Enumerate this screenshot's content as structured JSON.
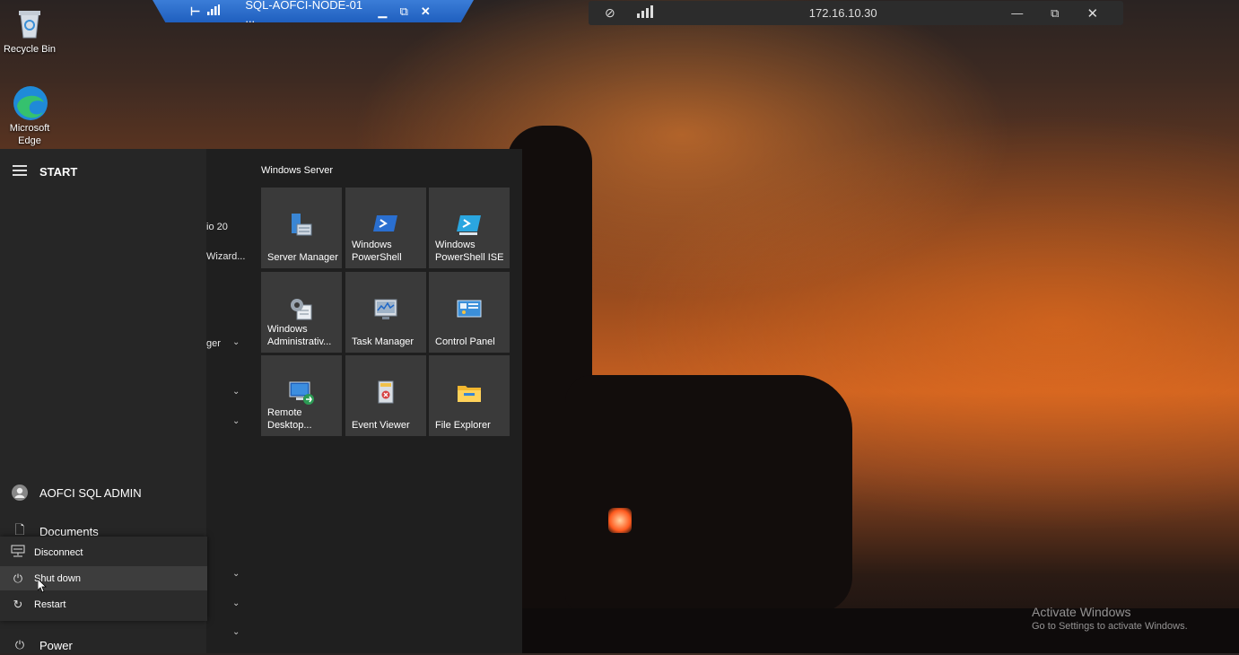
{
  "desktop": {
    "icons": [
      {
        "label": "Recycle Bin",
        "icon": "recycle-bin-icon"
      },
      {
        "label": "Microsoft Edge",
        "icon": "edge-icon"
      }
    ]
  },
  "rdp_bar": {
    "title": "SQL-AOFCI-NODE-01 ...",
    "pin_icon": "pin-icon",
    "signal_icon": "signal-icon",
    "minimize_icon": "minimize-icon",
    "restore_icon": "restore-icon",
    "close_icon": "close-icon"
  },
  "connection_bar": {
    "address": "172.16.10.30",
    "unpin_icon": "unpin-icon",
    "signal_icon": "signal-icon",
    "minimize_icon": "minimize-icon",
    "restore_icon": "restore-icon",
    "close_icon": "close-icon"
  },
  "start_menu": {
    "title": "START",
    "user_name": "AOFCI SQL ADMIN",
    "documents_label": "Documents",
    "power_label": "Power",
    "power_menu": [
      {
        "label": "Disconnect",
        "icon": "disconnect-icon"
      },
      {
        "label": "Shut down",
        "icon": "power-icon"
      },
      {
        "label": "Restart",
        "icon": "restart-icon"
      }
    ],
    "app_list_fragments": [
      "io 20",
      "Wizard...",
      "ger"
    ],
    "tile_group_title": "Windows Server",
    "tiles": [
      {
        "label": "Server Manager",
        "icon": "server-manager-icon"
      },
      {
        "label": "Windows PowerShell",
        "icon": "powershell-icon"
      },
      {
        "label": "Windows PowerShell ISE",
        "icon": "powershell-ise-icon"
      },
      {
        "label": "Windows Administrativ...",
        "icon": "admin-tools-icon"
      },
      {
        "label": "Task Manager",
        "icon": "task-manager-icon"
      },
      {
        "label": "Control Panel",
        "icon": "control-panel-icon"
      },
      {
        "label": "Remote Desktop...",
        "icon": "remote-desktop-icon"
      },
      {
        "label": "Event Viewer",
        "icon": "event-viewer-icon"
      },
      {
        "label": "File Explorer",
        "icon": "file-explorer-icon"
      }
    ]
  },
  "watermark": {
    "title": "Activate Windows",
    "subtitle": "Go to Settings to activate Windows."
  },
  "colors": {
    "rdp_blue": "#1f5fbf",
    "start_bg": "#1f1f1f",
    "tile_bg": "#3a3a3a",
    "highlight": "#3d3d3d"
  }
}
